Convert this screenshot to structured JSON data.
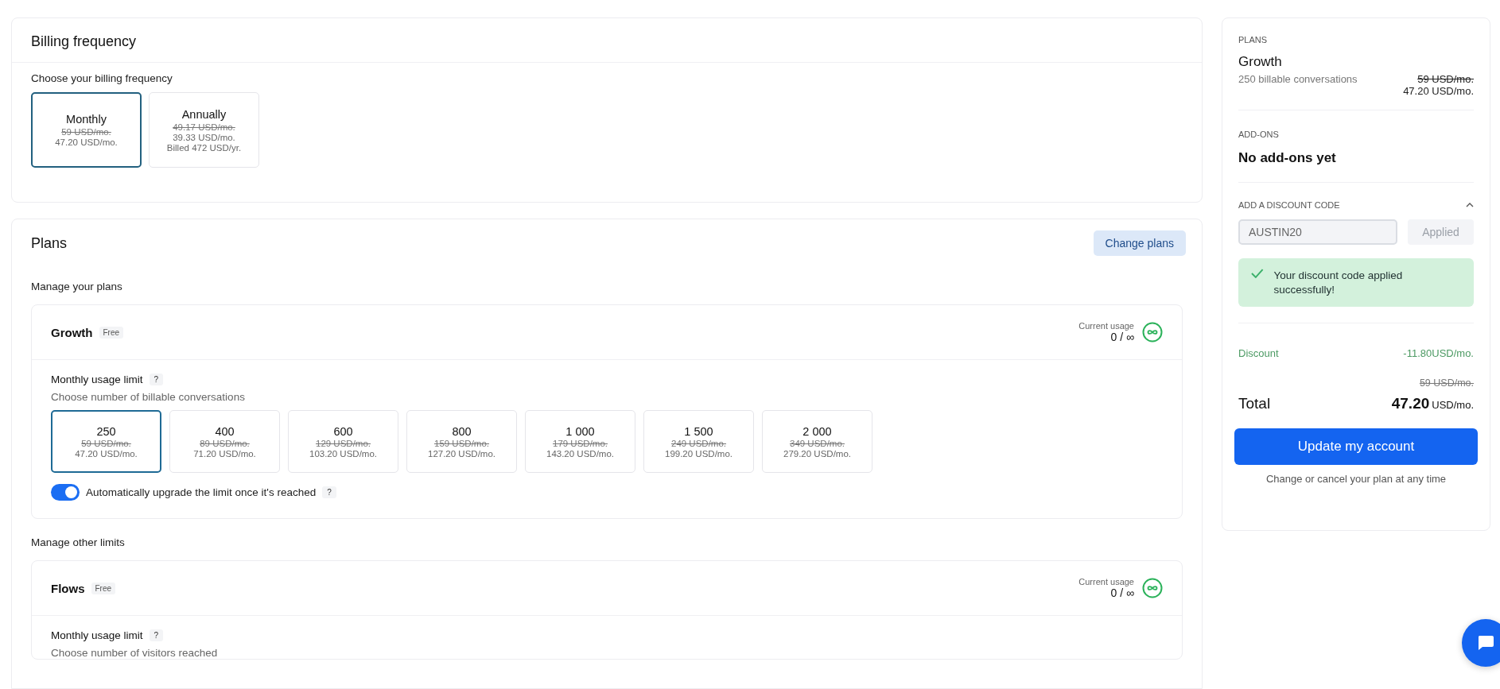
{
  "billing": {
    "title": "Billing frequency",
    "prompt": "Choose your billing frequency",
    "options": [
      {
        "label": "Monthly",
        "old_price": "59 USD/mo.",
        "price": "47.20 USD/mo.",
        "selected": true
      },
      {
        "label": "Annually",
        "old_price": "49.17 USD/mo.",
        "price": "39.33 USD/mo.",
        "note": "Billed 472 USD/yr.",
        "selected": false
      }
    ]
  },
  "plans": {
    "title": "Plans",
    "change_button": "Change plans",
    "subtitle": "Manage your plans",
    "plan_cards": [
      {
        "name": "Growth",
        "badge": "Free",
        "usage_label": "Current usage",
        "usage": "0 / ∞",
        "limit_label": "Monthly usage limit",
        "help": "?",
        "limit_hint": "Choose number of billable conversations",
        "tiers": [
          {
            "amount": "250",
            "old_price": "59 USD/mo.",
            "price": "47.20 USD/mo.",
            "selected": true
          },
          {
            "amount": "400",
            "old_price": "89 USD/mo.",
            "price": "71.20 USD/mo.",
            "selected": false
          },
          {
            "amount": "600",
            "old_price": "129 USD/mo.",
            "price": "103.20 USD/mo.",
            "selected": false
          },
          {
            "amount": "800",
            "old_price": "159 USD/mo.",
            "price": "127.20 USD/mo.",
            "selected": false
          },
          {
            "amount": "1 000",
            "old_price": "179 USD/mo.",
            "price": "143.20 USD/mo.",
            "selected": false
          },
          {
            "amount": "1 500",
            "old_price": "249 USD/mo.",
            "price": "199.20 USD/mo.",
            "selected": false
          },
          {
            "amount": "2 000",
            "old_price": "349 USD/mo.",
            "price": "279.20 USD/mo.",
            "selected": false
          }
        ],
        "auto_upgrade": {
          "label": "Automatically upgrade the limit once it's reached",
          "on": true,
          "help": "?"
        }
      }
    ],
    "other_title": "Manage other limits",
    "other_cards": [
      {
        "name": "Flows",
        "badge": "Free",
        "usage_label": "Current usage",
        "usage": "0 / ∞",
        "limit_label": "Monthly usage limit",
        "help": "?",
        "limit_hint": "Choose number of visitors reached"
      }
    ]
  },
  "summary": {
    "plans_label": "PLANS",
    "plan_name": "Growth",
    "plan_desc": "250 billable conversations",
    "old_price": "59 USD/mo.",
    "price": "47.20 USD/mo.",
    "addons_label": "ADD-ONS",
    "addons_text": "No add-ons yet",
    "discount": {
      "label": "ADD A DISCOUNT CODE",
      "expanded": true,
      "code": "AUSTIN20",
      "apply_button": "Applied",
      "apply_disabled": true,
      "success": "Your discount code applied successfully!"
    },
    "discount_row": {
      "label": "Discount",
      "value": "-11.80USD/mo."
    },
    "total_old": "59 USD/mo.",
    "total_label": "Total",
    "total_amount": "47.20",
    "total_unit": "USD/mo.",
    "update_button": "Update my account",
    "footnote": "Change or cancel your plan at any time"
  }
}
